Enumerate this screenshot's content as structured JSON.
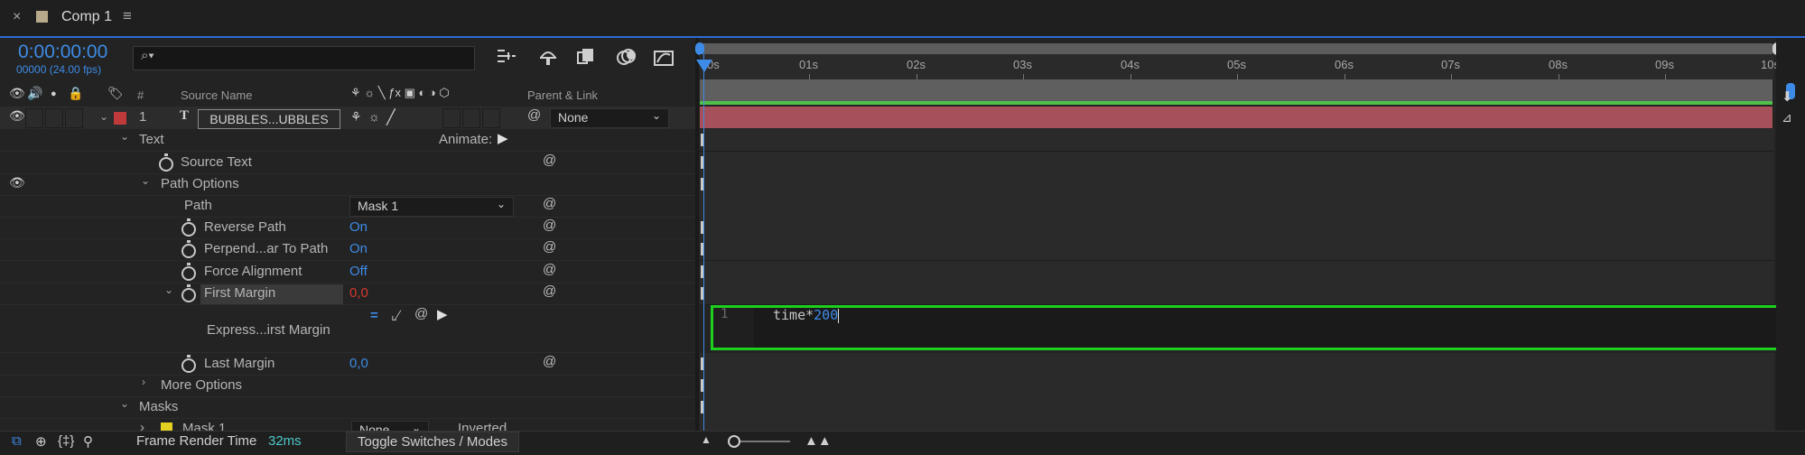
{
  "tab": {
    "close": "×",
    "title": "Comp 1",
    "menu": "≡"
  },
  "header": {
    "timecode": "0:00:00:00",
    "fps": "00000 (24.00 fps)",
    "search_icon": "⌕▾"
  },
  "columns": {
    "hash": "#",
    "source_name": "Source Name",
    "parent_link": "Parent & Link"
  },
  "layer": {
    "index": "1",
    "type_glyph": "T",
    "name": "BUBBLES...UBBLES",
    "parent": "None",
    "label_color": "#c0393b"
  },
  "props": {
    "text": "Text",
    "animate": "Animate:",
    "source_text": "Source Text",
    "path_options": "Path Options",
    "path": "Path",
    "path_value": "Mask 1",
    "reverse_path": "Reverse Path",
    "reverse_path_value": "On",
    "perpendicular": "Perpend...ar To Path",
    "perpendicular_value": "On",
    "force_alignment": "Force Alignment",
    "force_alignment_value": "Off",
    "first_margin": "First Margin",
    "first_margin_value": "0,0",
    "expression": "Express...irst Margin",
    "last_margin": "Last Margin",
    "last_margin_value": "0,0",
    "more_options": "More Options",
    "masks": "Masks",
    "mask1": "Mask 1",
    "mask_mode": "None",
    "inverted": "Inverted"
  },
  "ruler": {
    "labels": [
      "0s",
      "01s",
      "02s",
      "03s",
      "04s",
      "05s",
      "06s",
      "07s",
      "08s",
      "09s",
      "10s"
    ]
  },
  "expression_editor": {
    "line_number": "1",
    "code_keyword": "time",
    "code_operator": "*",
    "code_number": "200"
  },
  "statusbar": {
    "frame_render_label": "Frame Render Time",
    "frame_render_value": "32ms",
    "toggle": "Toggle Switches / Modes"
  },
  "colors": {
    "accent": "#3d8be6",
    "highlight": "#1ed01e",
    "layer_bar": "#a5505a",
    "work_area_green": "#4fc04a"
  }
}
